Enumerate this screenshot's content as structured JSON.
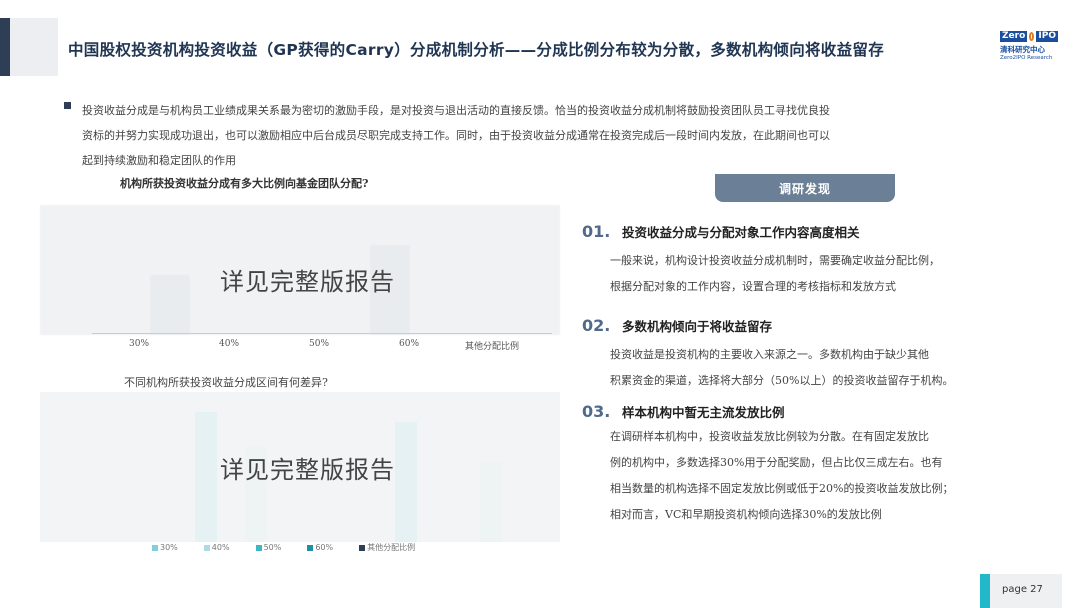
{
  "header": {
    "title": "中国股权投资机构投资收益（GP获得的Carry）分成机制分析——分成比例分布较为分散，多数机构倾向将收益留存",
    "logo": {
      "zero": "Zero",
      "ipo": "IPO",
      "cn": "清科研究中心",
      "en": "Zero2IPO Research"
    }
  },
  "intro": {
    "lines": [
      "投资收益分成是与机构员工业绩成果关系最为密切的激励手段，是对投资与退出活动的直接反馈。恰当的投资收益分成机制将鼓励投资团队员工寻找优良投",
      "资标的并努力实现成功退出，也可以激励相应中后台成员尽职完成支持工作。同时，由于投资收益分成通常在投资完成后一段时间内发放，在此期间也可以",
      "起到持续激励和稳定团队的作用"
    ]
  },
  "chart1": {
    "question": "机构所获投资收益分成有多大比例向基金团队分配?",
    "watermark": "详见完整版报告",
    "axis_labels": [
      "30%",
      "40%",
      "50%",
      "60%",
      "其他分配比例"
    ]
  },
  "chart2": {
    "question": "不同机构所获投资收益分成区间有何差异?",
    "watermark": "详见完整版报告",
    "legend": [
      "30%",
      "40%",
      "50%",
      "60%",
      "其他分配比例"
    ],
    "legend_colors": [
      "#7fd0da",
      "#a9dce4",
      "#3fb5c8",
      "#1f8fa6",
      "#2e3f55"
    ]
  },
  "findings": {
    "tab_label": "调研发现",
    "items": [
      {
        "num": "01.",
        "title": "投资收益分成与分配对象工作内容高度相关",
        "lines": [
          "一般来说，机构设计投资收益分成机制时，需要确定收益分配比例，",
          "根据分配对象的工作内容，设置合理的考核指标和发放方式"
        ]
      },
      {
        "num": "02.",
        "title": "多数机构倾向于将收益留存",
        "lines": [
          "投资收益是投资机构的主要收入来源之一。多数机构由于缺少其他",
          "积累资金的渠道，选择将大部分（50%以上）的投资收益留存于机构。"
        ]
      },
      {
        "num": "03.",
        "title": "样本机构中暂无主流发放比例",
        "lines": [
          "在调研样本机构中，投资收益发放比例较为分散。在有固定发放比",
          "例的机构中，多数选择30%用于分配奖励，但占比仅三成左右。也有",
          "相当数量的机构选择不固定发放比例或低于20%的投资收益发放比例；",
          "相对而言，VC和早期投资机构倾向选择30%的发放比例"
        ]
      }
    ]
  },
  "footer": {
    "page_label": "page  27"
  }
}
